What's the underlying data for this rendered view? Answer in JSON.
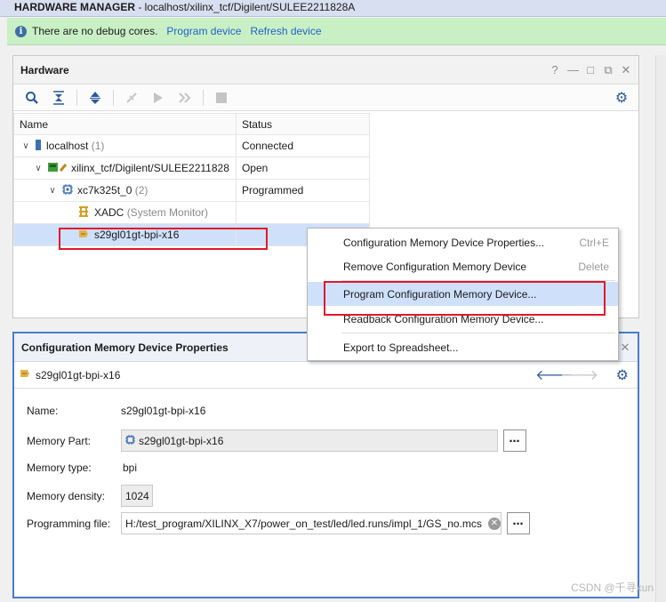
{
  "header": {
    "title_bold": "HARDWARE MANAGER",
    "title_rest": " - localhost/xilinx_tcf/Digilent/SULEE2211828A"
  },
  "info_bar": {
    "message": "There are no debug cores.",
    "link_program": "Program device",
    "link_refresh": "Refresh device"
  },
  "hardware_panel": {
    "title": "Hardware",
    "title_buttons": [
      "?",
      "—",
      "□",
      "⧉",
      "✕"
    ],
    "columns": [
      "Name",
      "Status"
    ],
    "rows": [
      {
        "name": "localhost",
        "suffix": "(1)",
        "status": "Connected"
      },
      {
        "name": "xilinx_tcf/Digilent/SULEE2211828",
        "suffix": "",
        "status": "Open"
      },
      {
        "name": "xc7k325t_0",
        "suffix": "(2)",
        "status": "Programmed"
      },
      {
        "name": "XADC",
        "suffix": "(System Monitor)",
        "status": ""
      },
      {
        "name": "s29gl01gt-bpi-x16",
        "suffix": "",
        "status": ""
      }
    ]
  },
  "context_menu": {
    "items": [
      {
        "label": "Configuration Memory Device Properties...",
        "shortcut": "Ctrl+E"
      },
      {
        "label": "Remove Configuration Memory Device",
        "shortcut": "Delete"
      },
      {
        "label": "Program Configuration Memory Device...",
        "shortcut": ""
      },
      {
        "label": "Readback Configuration Memory Device...",
        "shortcut": ""
      },
      {
        "label": "Export to Spreadsheet...",
        "shortcut": ""
      }
    ]
  },
  "props_panel": {
    "title": "Configuration Memory Device Properties",
    "device": "s29gl01gt-bpi-x16",
    "fields": {
      "name_label": "Name:",
      "name_value": "s29gl01gt-bpi-x16",
      "part_label": "Memory Part:",
      "part_value": "s29gl01gt-bpi-x16",
      "type_label": "Memory type:",
      "type_value": "bpi",
      "density_label": "Memory density:",
      "density_value": "1024",
      "file_label": "Programming file:",
      "file_value": "H:/test_program/XILINX_X7/power_on_test/led/led.runs/impl_1/GS_no.mcs"
    },
    "dots_label": "⋯"
  },
  "watermark": "CSDN @千寻xun",
  "colors": {
    "accent": "#4a7bd0",
    "selection": "#cfe0fb",
    "highlight_box": "#e0192a",
    "info_green": "#c9f0c5"
  }
}
